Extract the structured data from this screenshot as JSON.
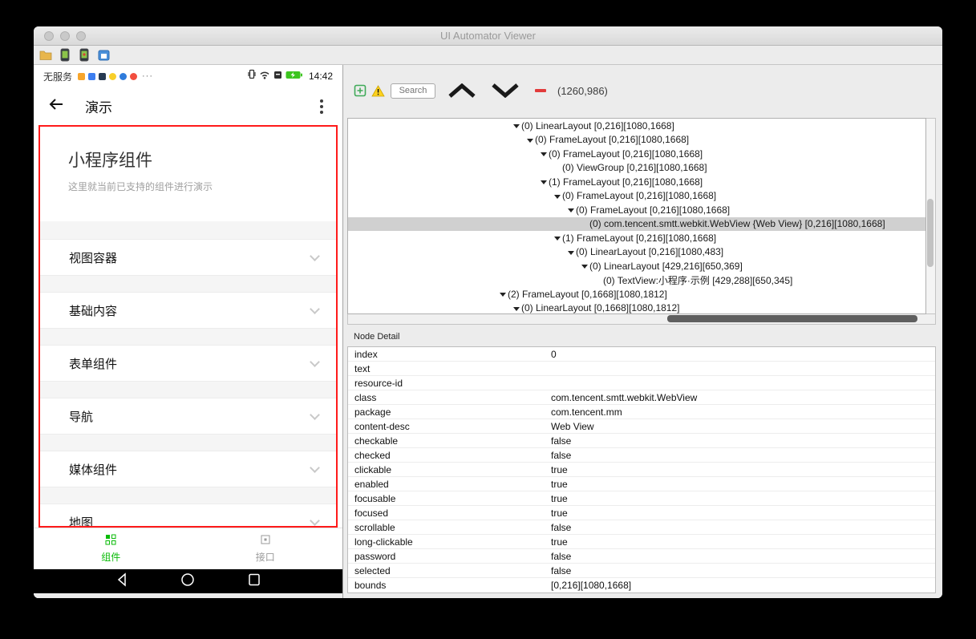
{
  "window": {
    "title": "UI Automator Viewer"
  },
  "colors": {
    "wechat_green": "#09bb07",
    "highlight_red": "#ff1a1a",
    "tree_selection": "#d0d0d0"
  },
  "phone": {
    "status_bar": {
      "carrier": "无服务",
      "overflow": "···",
      "time": "14:42"
    },
    "nav_bar": {
      "title": "演示"
    },
    "header": {
      "title": "小程序组件",
      "subtitle": "这里就当前已支持的组件进行演示"
    },
    "sections": [
      "视图容器",
      "基础内容",
      "表单组件",
      "导航",
      "媒体组件",
      "地图"
    ],
    "tabs": [
      {
        "label": "组件",
        "active": true
      },
      {
        "label": "接口",
        "active": false
      }
    ]
  },
  "tree": {
    "search_placeholder": "Search",
    "coordinates": "(1260,986)",
    "nodes": [
      {
        "depth": 1,
        "expanded": true,
        "selected": false,
        "label": "(0) LinearLayout [0,216][1080,1668]"
      },
      {
        "depth": 2,
        "expanded": true,
        "selected": false,
        "label": "(0) FrameLayout [0,216][1080,1668]"
      },
      {
        "depth": 3,
        "expanded": true,
        "selected": false,
        "label": "(0) FrameLayout [0,216][1080,1668]"
      },
      {
        "depth": 4,
        "expanded": false,
        "selected": false,
        "label": "(0) ViewGroup [0,216][1080,1668]"
      },
      {
        "depth": 3,
        "expanded": true,
        "selected": false,
        "label": "(1) FrameLayout [0,216][1080,1668]"
      },
      {
        "depth": 4,
        "expanded": true,
        "selected": false,
        "label": "(0) FrameLayout [0,216][1080,1668]"
      },
      {
        "depth": 5,
        "expanded": true,
        "selected": false,
        "label": "(0) FrameLayout [0,216][1080,1668]"
      },
      {
        "depth": 6,
        "expanded": false,
        "selected": true,
        "label": "(0) com.tencent.smtt.webkit.WebView {Web View} [0,216][1080,1668]"
      },
      {
        "depth": 4,
        "expanded": true,
        "selected": false,
        "label": "(1) FrameLayout [0,216][1080,1668]"
      },
      {
        "depth": 5,
        "expanded": true,
        "selected": false,
        "label": "(0) LinearLayout [0,216][1080,483]"
      },
      {
        "depth": 6,
        "expanded": true,
        "selected": false,
        "label": "(0) LinearLayout [429,216][650,369]"
      },
      {
        "depth": 7,
        "expanded": false,
        "selected": false,
        "label": "(0) TextView:小程序·示例 [429,288][650,345]"
      },
      {
        "depth": 0,
        "expanded": true,
        "selected": false,
        "label": "(2) FrameLayout [0,1668][1080,1812]"
      },
      {
        "depth": 1,
        "expanded": true,
        "selected": false,
        "label": "(0) LinearLayout [0,1668][1080,1812]"
      }
    ]
  },
  "node_detail": {
    "title": "Node Detail",
    "rows": [
      {
        "key": "index",
        "value": "0"
      },
      {
        "key": "text",
        "value": ""
      },
      {
        "key": "resource-id",
        "value": ""
      },
      {
        "key": "class",
        "value": "com.tencent.smtt.webkit.WebView"
      },
      {
        "key": "package",
        "value": "com.tencent.mm"
      },
      {
        "key": "content-desc",
        "value": "Web View"
      },
      {
        "key": "checkable",
        "value": "false"
      },
      {
        "key": "checked",
        "value": "false"
      },
      {
        "key": "clickable",
        "value": "true"
      },
      {
        "key": "enabled",
        "value": "true"
      },
      {
        "key": "focusable",
        "value": "true"
      },
      {
        "key": "focused",
        "value": "true"
      },
      {
        "key": "scrollable",
        "value": "false"
      },
      {
        "key": "long-clickable",
        "value": "true"
      },
      {
        "key": "password",
        "value": "false"
      },
      {
        "key": "selected",
        "value": "false"
      },
      {
        "key": "bounds",
        "value": "[0,216][1080,1668]"
      }
    ]
  }
}
